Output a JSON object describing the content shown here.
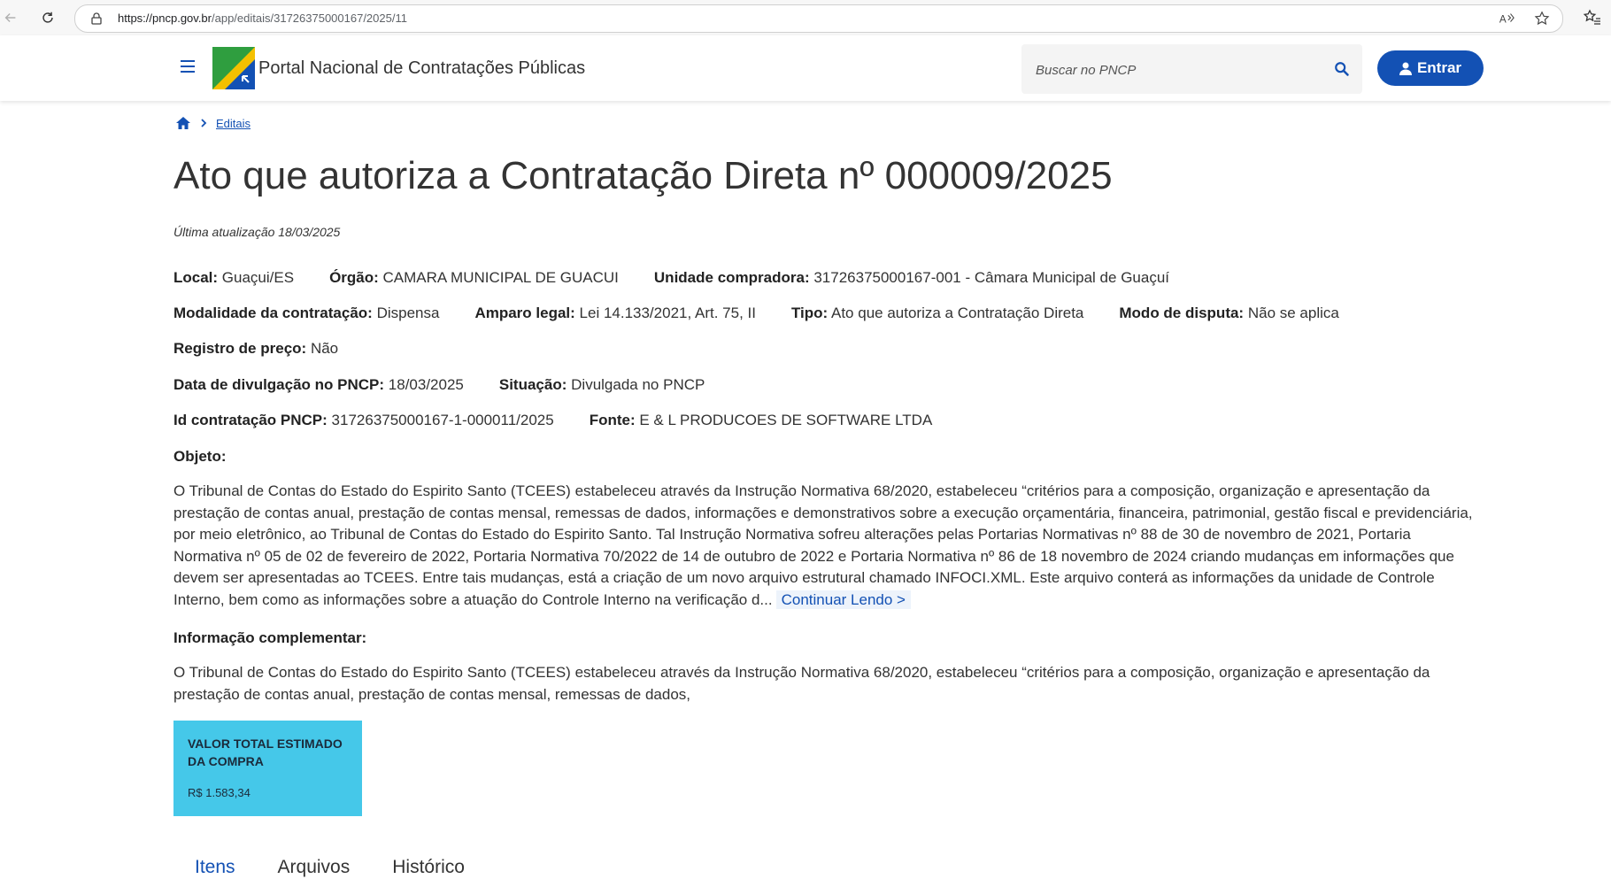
{
  "browser": {
    "url_host": "https://pncp.gov.br",
    "url_path": "/app/editais/31726375000167/2025/11"
  },
  "header": {
    "site_title": "Portal Nacional de Contratações Públicas",
    "search_placeholder": "Buscar no PNCP",
    "login_label": "Entrar",
    "brand_color": "#1351b4"
  },
  "breadcrumb": {
    "items": [
      "Editais"
    ]
  },
  "page": {
    "title": "Ato que autoriza a Contratação Direta nº 000009/2025",
    "last_update": "Última atualização 18/03/2025"
  },
  "fields": {
    "local": {
      "label": "Local:",
      "value": "Guaçui/ES"
    },
    "orgao": {
      "label": "Órgão:",
      "value": "CAMARA MUNICIPAL DE GUACUI"
    },
    "unidade": {
      "label": "Unidade compradora:",
      "value": "31726375000167-001 - Câmara Municipal de Guaçuí"
    },
    "modalidade": {
      "label": "Modalidade da contratação:",
      "value": "Dispensa"
    },
    "amparo": {
      "label": "Amparo legal:",
      "value": "Lei 14.133/2021, Art. 75, II"
    },
    "tipo": {
      "label": "Tipo:",
      "value": "Ato que autoriza a Contratação Direta"
    },
    "modo_disputa": {
      "label": "Modo de disputa:",
      "value": "Não se aplica"
    },
    "registro_preco": {
      "label": "Registro de preço:",
      "value": "Não"
    },
    "data_divulgacao": {
      "label": "Data de divulgação no PNCP:",
      "value": "18/03/2025"
    },
    "situacao": {
      "label": "Situação:",
      "value": "Divulgada no PNCP"
    },
    "id_contratacao": {
      "label": "Id contratação PNCP:",
      "value": "31726375000167-1-000011/2025"
    },
    "fonte": {
      "label": "Fonte:",
      "value": "E & L PRODUCOES DE SOFTWARE LTDA"
    }
  },
  "objeto": {
    "label": "Objeto:",
    "text": "O Tribunal de Contas do Estado do Espirito Santo (TCEES) estabeleceu através da Instrução Normativa 68/2020, estabeleceu “critérios para a composição, organização e apresentação da prestação de contas anual, prestação de contas mensal, remessas de dados, informações e demonstrativos sobre a execução orçamentária, financeira, patrimonial, gestão fiscal e previdenciária, por meio eletrônico, ao Tribunal de Contas do Estado do Espirito Santo. Tal Instrução Normativa sofreu alterações pelas Portarias Normativas nº 88 de 30 de novembro de 2021, Portaria Normativa nº 05 de 02 de fevereiro de 2022, Portaria Normativa 70/2022 de 14 de outubro de 2022 e Portaria Normativa nº 86 de 18 novembro de 2024 criando mudanças em informações que devem ser apresentadas ao TCEES. Entre tais mudanças, está a criação de um novo arquivo estrutural chamado INFOCI.XML. Este arquivo conterá as informações da unidade de Controle Interno, bem como as informações sobre a atuação do Controle Interno na verificação d...",
    "continue_label": "Continuar Lendo >"
  },
  "info_complementar": {
    "label": "Informação complementar:",
    "text": "O Tribunal de Contas do Estado do Espirito Santo (TCEES) estabeleceu através da Instrução Normativa 68/2020, estabeleceu “critérios para a composição, organização e apresentação da prestação de contas anual, prestação de contas mensal, remessas de dados,"
  },
  "valor_card": {
    "label": "VALOR TOTAL ESTIMADO DA COMPRA",
    "value": "R$ 1.583,34",
    "color": "#45c8e9"
  },
  "tabs": [
    {
      "label": "Itens",
      "active": true
    },
    {
      "label": "Arquivos",
      "active": false
    },
    {
      "label": "Histórico",
      "active": false
    }
  ]
}
